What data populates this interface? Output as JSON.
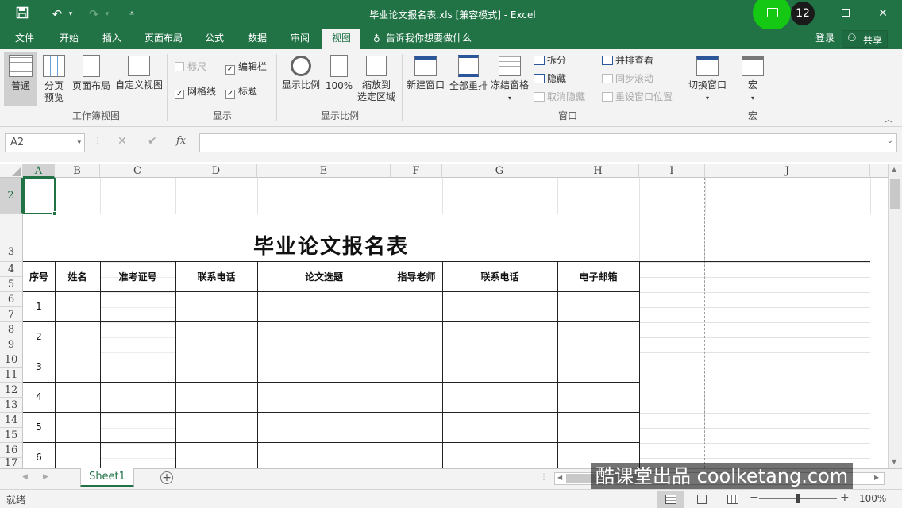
{
  "window": {
    "title": "毕业论文报名表.xls  [兼容模式] - Excel",
    "badge": "12",
    "badge_color": "#1a1a1a",
    "record_color": "#14c814"
  },
  "quick_access": {
    "save_icon": "save-icon",
    "undo_icon": "undo-icon",
    "redo_icon": "redo-icon",
    "customize_icon": "customize-icon"
  },
  "menu": {
    "tabs": [
      "文件",
      "开始",
      "插入",
      "页面布局",
      "公式",
      "数据",
      "审阅",
      "视图"
    ],
    "active": "视图",
    "tell_me": "告诉我你想要做什么",
    "login": "登录",
    "share": "共享"
  },
  "ribbon": {
    "workbook_views": {
      "normal": "普通",
      "page_break_1": "分页",
      "page_break_2": "预览",
      "page_layout": "页面布局",
      "custom_views": "自定义视图",
      "group": "工作簿视图"
    },
    "show": {
      "ruler": "标尺",
      "formula_bar": "编辑栏",
      "gridlines": "网格线",
      "headings": "标题",
      "group": "显示"
    },
    "zoom": {
      "zoom": "显示比例",
      "hundred": "100%",
      "to_selection_1": "缩放到",
      "to_selection_2": "选定区域",
      "group": "显示比例"
    },
    "window": {
      "new_window": "新建窗口",
      "arrange_all": "全部重排",
      "freeze": "冻结窗格",
      "split": "拆分",
      "hide": "隐藏",
      "unhide": "取消隐藏",
      "side_by_side": "并排查看",
      "sync_scroll": "同步滚动",
      "reset_position": "重设窗口位置",
      "switch": "切换窗口",
      "group": "窗口"
    },
    "macros": {
      "macro": "宏",
      "group": "宏"
    }
  },
  "formula_bar": {
    "name_box": "A2",
    "cancel": "✕",
    "enter": "✔",
    "fx": "fx",
    "value": ""
  },
  "columns": [
    "A",
    "B",
    "C",
    "D",
    "E",
    "F",
    "G",
    "H",
    "I",
    "J"
  ],
  "rows": [
    "2",
    "3",
    "4",
    "5",
    "6",
    "7",
    "8",
    "9",
    "10",
    "11",
    "12",
    "13",
    "14",
    "15",
    "16",
    "17"
  ],
  "table": {
    "title": "毕业论文报名表",
    "headers": [
      "序号",
      "姓名",
      "准考证号",
      "联系电话",
      "论文选题",
      "指导老师",
      "联系电话",
      "电子邮箱"
    ],
    "seq": [
      "1",
      "2",
      "3",
      "4",
      "5",
      "6"
    ]
  },
  "sheets": {
    "tabs": [
      "Sheet1"
    ],
    "active": "Sheet1"
  },
  "status": {
    "ready": "就绪",
    "zoom": "100%",
    "zoom_fraction": 0.5
  },
  "watermark": "酷课堂出品 coolketang.com"
}
